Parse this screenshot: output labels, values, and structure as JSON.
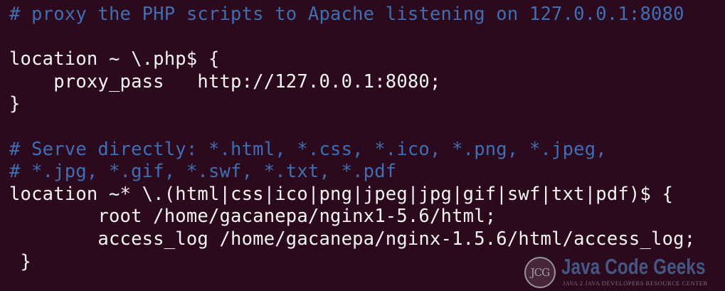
{
  "terminal": {
    "lines": [
      {
        "text": "# proxy the PHP scripts to Apache listening on 127.0.0.1:8080",
        "kind": "comment"
      },
      {
        "text": "",
        "kind": "blank"
      },
      {
        "text": "location ~ \\.php$ {",
        "kind": "code"
      },
      {
        "text": "    proxy_pass   http://127.0.0.1:8080;",
        "kind": "code"
      },
      {
        "text": "}",
        "kind": "code"
      },
      {
        "text": "",
        "kind": "blank"
      },
      {
        "text": "# Serve directly: *.html, *.css, *.ico, *.png, *.jpeg,",
        "kind": "comment"
      },
      {
        "text": "# *.jpg, *.gif, *.swf, *.txt, *.pdf",
        "kind": "comment"
      },
      {
        "text": "location ~* \\.(html|css|ico|png|jpeg|jpg|gif|swf|txt|pdf)$ {",
        "kind": "code"
      },
      {
        "text": "        root /home/gacanepa/nginx1-5.6/html;",
        "kind": "code"
      },
      {
        "text": "        access_log /home/gacanepa/nginx-1.5.6/html/access_log;",
        "kind": "code"
      },
      {
        "text": " }",
        "kind": "code"
      }
    ]
  },
  "watermark": {
    "logo_initials": "JCG",
    "title": "Java Code Geeks",
    "subtitle": "Java 2 Java Developers Resource Center"
  },
  "colors": {
    "background": "#2c0a1e",
    "comment": "#3f6eb3",
    "code": "#f4f4f2"
  }
}
